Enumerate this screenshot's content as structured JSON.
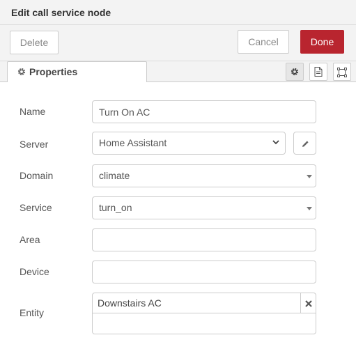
{
  "dialog": {
    "title": "Edit call service node"
  },
  "toolbar": {
    "delete_label": "Delete",
    "cancel_label": "Cancel",
    "done_label": "Done"
  },
  "tabs": {
    "properties_label": "Properties",
    "active_icon": "gear-icon",
    "side_icons": [
      "gear-icon",
      "description-icon",
      "appearance-icon"
    ]
  },
  "colors": {
    "done_button": "#b9252f",
    "header_bg": "#f3f3f3",
    "border": "#cccccc"
  },
  "form": {
    "name": {
      "label": "Name",
      "value": "Turn On AC"
    },
    "server": {
      "label": "Server",
      "value": "Home Assistant"
    },
    "domain": {
      "label": "Domain",
      "value": "climate"
    },
    "service": {
      "label": "Service",
      "value": "turn_on"
    },
    "area": {
      "label": "Area",
      "value": ""
    },
    "device": {
      "label": "Device",
      "value": ""
    },
    "entity": {
      "label": "Entity",
      "tags": [
        "Downstairs AC"
      ]
    }
  }
}
